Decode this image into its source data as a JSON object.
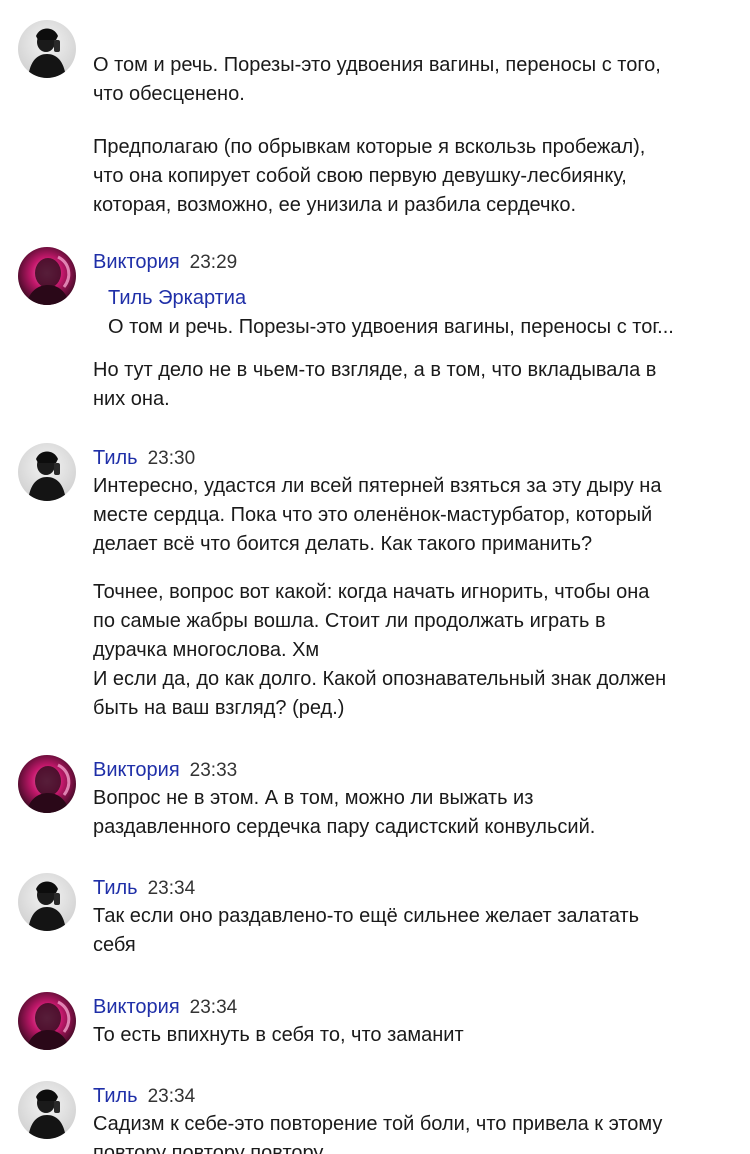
{
  "messages": [
    {
      "author": "",
      "time": "",
      "paragraphs": [
        "О том и речь. Порезы-это удвоения вагины, переносы с того,\nчто обесценено.",
        "Предполагаю (по обрывкам которые я вскользь пробежал),\nчто она копирует собой свою первую девушку-лесбиянку,\nкоторая, возможно, ее унизила и разбила сердечко."
      ]
    },
    {
      "author": "Виктория",
      "time": "23:29",
      "quote": {
        "author": "Тиль Эркартиа",
        "text": "О том и речь. Порезы-это удвоения вагины, переносы с тог..."
      },
      "paragraphs": [
        "Но тут дело не в чьем-то взгляде, а в том, что вкладывала в\nних она."
      ]
    },
    {
      "author": "Тиль",
      "time": "23:30",
      "paragraphs": [
        "Интересно, удастся ли всей пятерней взяться за эту дыру на\nместе сердца. Пока что это оленёнок-мастурбатор, который\nделает всё что боится делать. Как такого приманить?",
        "Точнее, вопрос вот какой: когда начать игнорить, чтобы она\nпо самые жабры вошла. Стоит ли продолжать играть в\nдурачка многослова. Хм\nИ если да, до как долго. Какой опознавательный знак должен\nбыть на ваш взгляд? (ред.)"
      ]
    },
    {
      "author": "Виктория",
      "time": "23:33",
      "paragraphs": [
        "Вопрос не в этом. А в том, можно ли выжать из\nраздавленного сердечка пару садистский конвульсий."
      ]
    },
    {
      "author": "Тиль",
      "time": "23:34",
      "paragraphs": [
        "Так если оно раздавлено-то ещё сильнее желает залатать\nсебя"
      ]
    },
    {
      "author": "Виктория",
      "time": "23:34",
      "paragraphs": [
        "То есть впихнуть в себя то, что заманит"
      ]
    },
    {
      "author": "Тиль",
      "time": "23:34",
      "paragraphs": [
        "Садизм к себе-это повторение той боли, что привела к этому\nповтору повтору повтору"
      ]
    }
  ],
  "colors": {
    "author_link": "#1f2fa8",
    "text": "#1a1a1a",
    "background": "#ffffff"
  },
  "icons": {
    "til_avatar": "dark-figure-avatar",
    "viktoria_avatar": "pink-portrait-avatar"
  }
}
